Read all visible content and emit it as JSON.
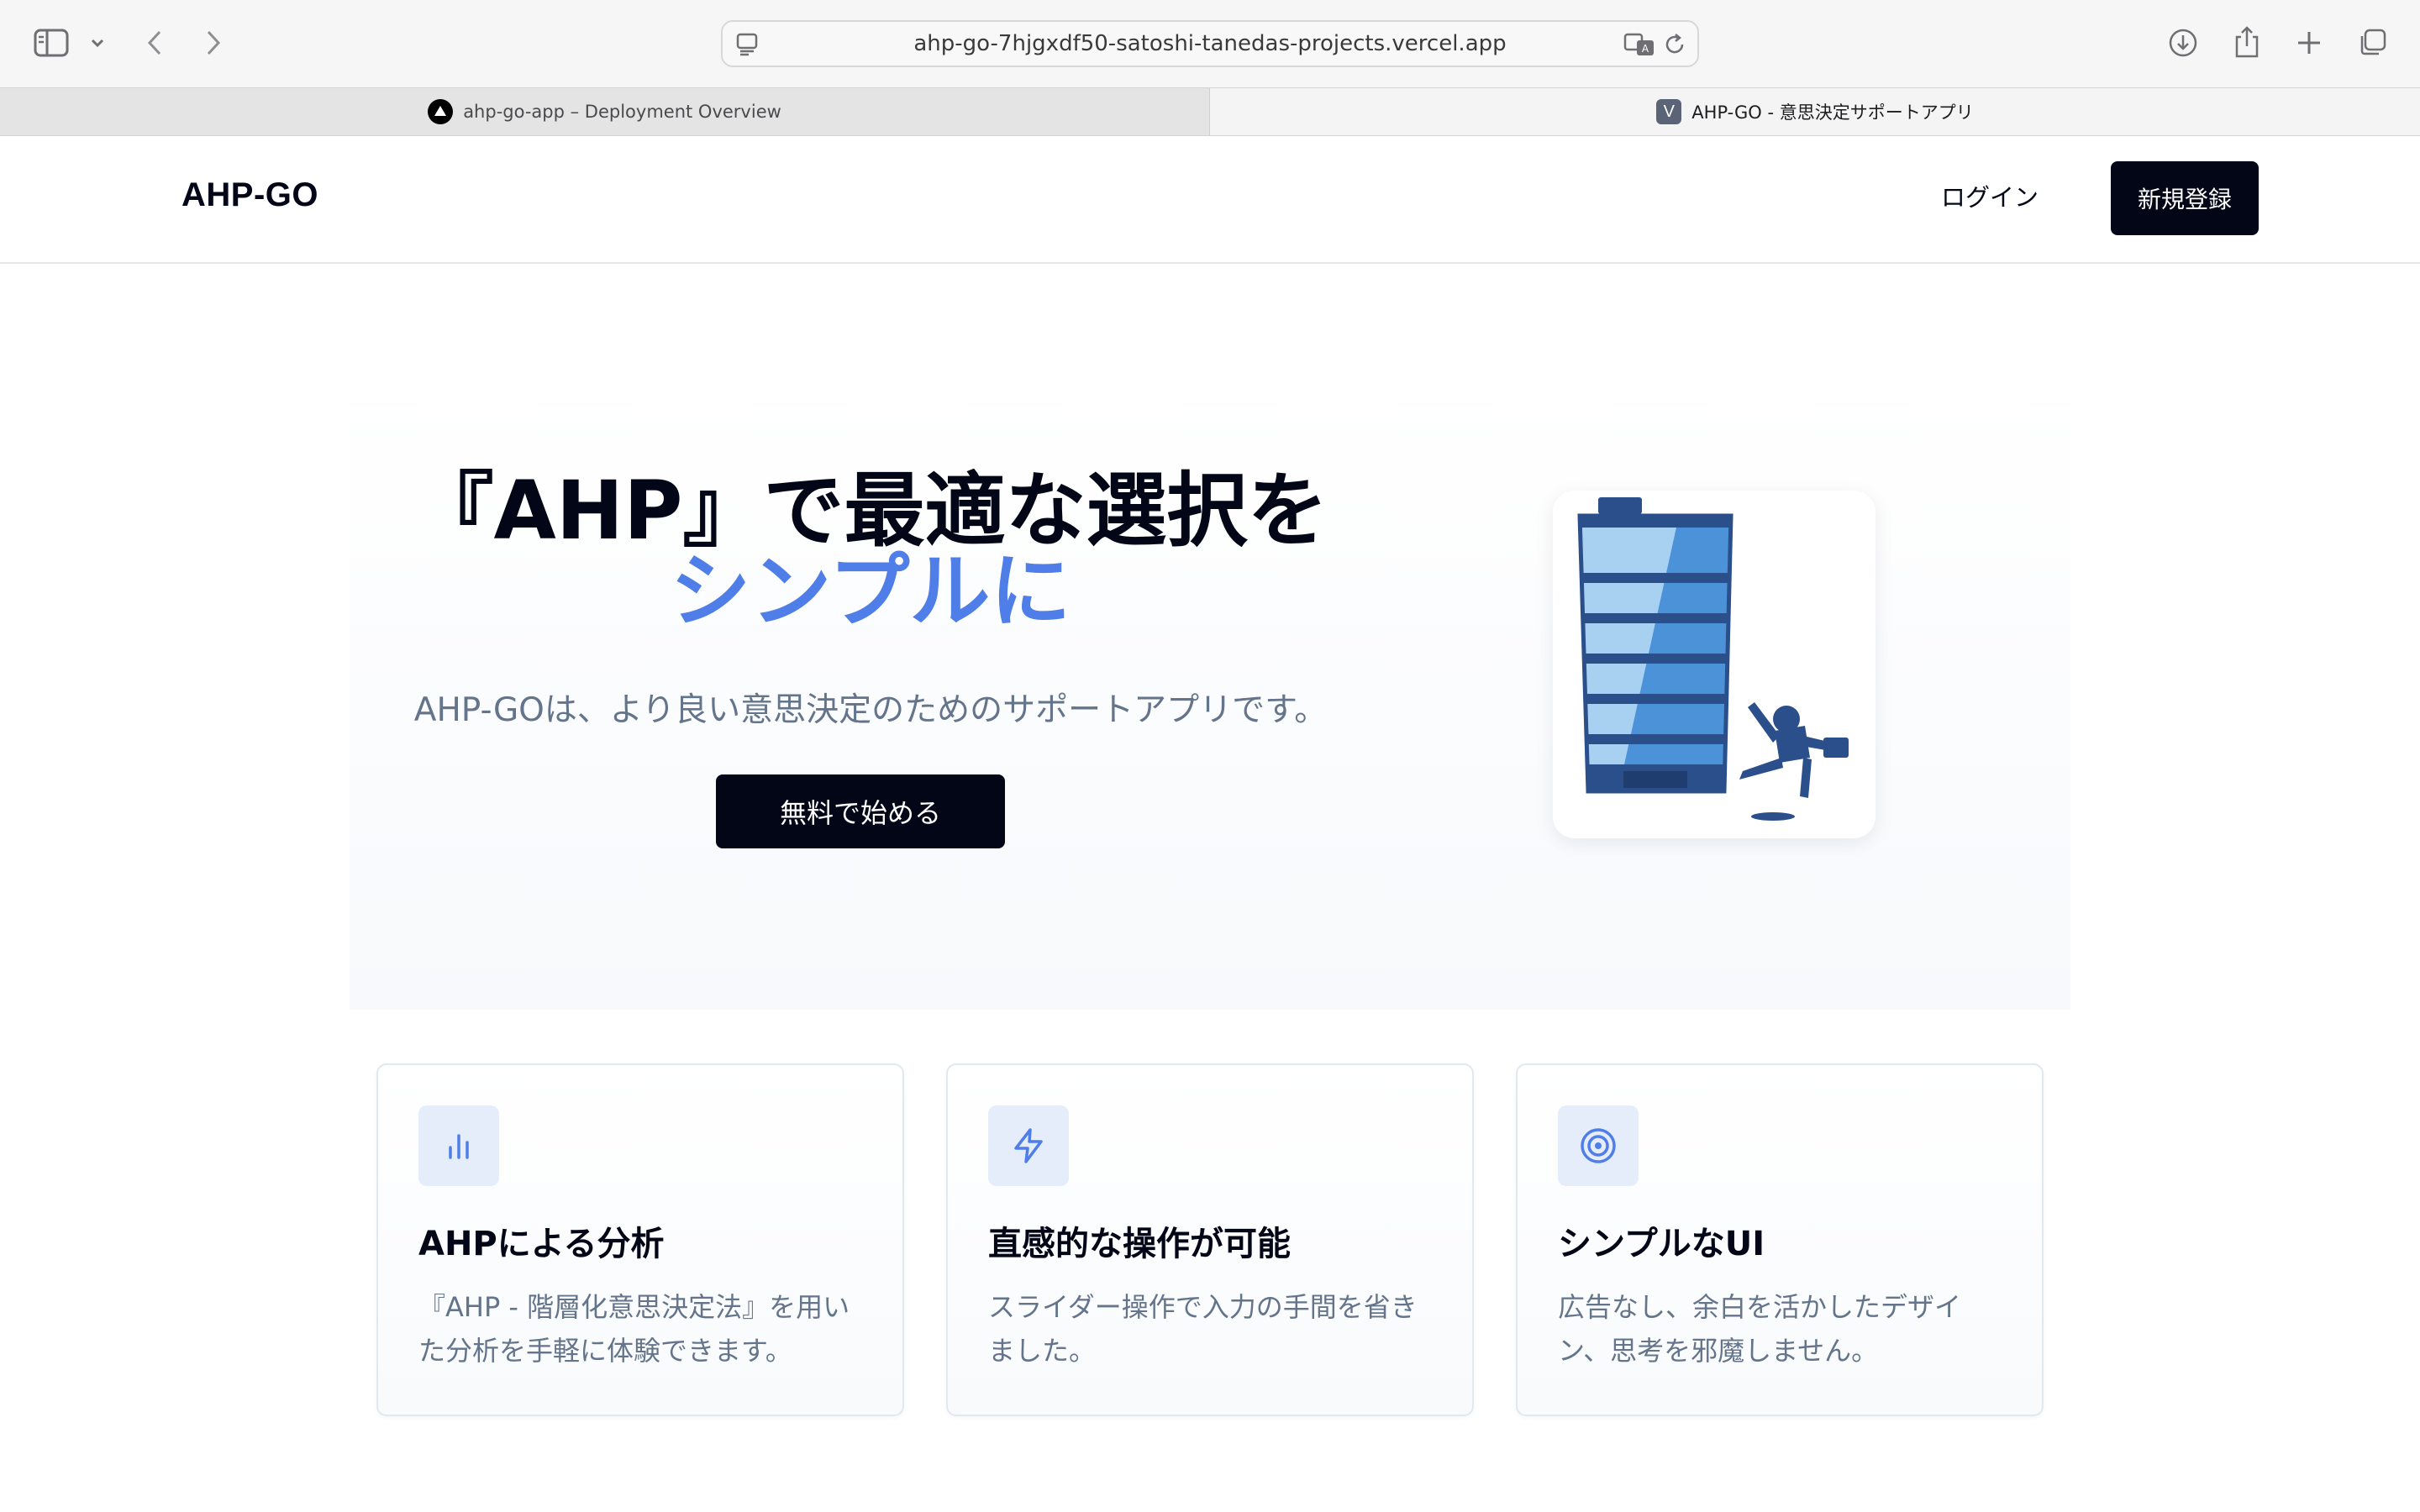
{
  "browser": {
    "url": "ahp-go-7hjgxdf50-satoshi-tanedas-projects.vercel.app",
    "tabs": [
      {
        "label": "ahp-go-app – Deployment Overview",
        "favicon": "vercel-triangle-icon"
      },
      {
        "label": "AHP-GO - 意思決定サポートアプリ",
        "favicon": "v-letter-icon"
      }
    ]
  },
  "header": {
    "logo": "AHP-GO",
    "login_label": "ログイン",
    "signup_label": "新規登録"
  },
  "hero": {
    "title_line1": "『AHP』で最適な選択を",
    "title_line2": "シンプルに",
    "subtitle": "AHP-GOは、より良い意思決定のためのサポートアプリです。",
    "cta_label": "無料で始める",
    "illustration": "falling-battery-businessman-illustration"
  },
  "features": [
    {
      "icon": "bar-chart-icon",
      "title": "AHPによる分析",
      "text": "『AHP - 階層化意思決定法』を用いた分析を手軽に体験できます。"
    },
    {
      "icon": "lightning-icon",
      "title": "直感的な操作が可能",
      "text": "スライダー操作で入力の手間を省きました。"
    },
    {
      "icon": "target-icon",
      "title": "シンプルなUI",
      "text": "広告なし、余白を活かしたデザイン、思考を邪魔しません。"
    }
  ],
  "colors": {
    "accent_blue": "#4f7ee8",
    "primary_dark": "#020617",
    "muted_text": "#64748b",
    "icon_bg": "#e5edfb"
  }
}
